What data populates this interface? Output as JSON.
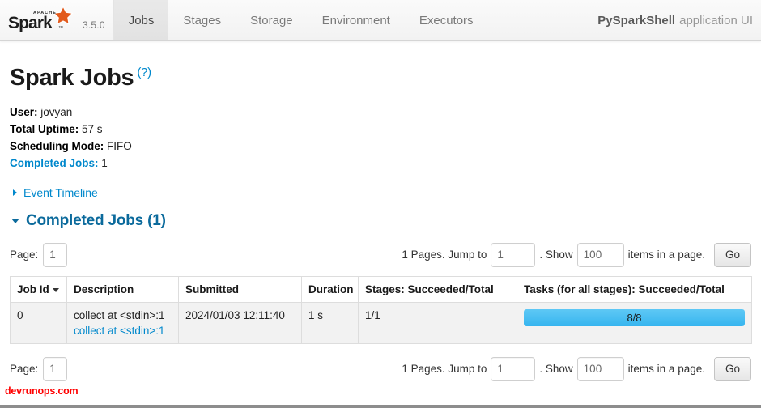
{
  "navbar": {
    "logo_alt": "Apache Spark",
    "logo_apache_text": "APACHE",
    "logo_word": "Spark",
    "version": "3.5.0",
    "tabs": [
      {
        "label": "Jobs",
        "active": true
      },
      {
        "label": "Stages",
        "active": false
      },
      {
        "label": "Storage",
        "active": false
      },
      {
        "label": "Environment",
        "active": false
      },
      {
        "label": "Executors",
        "active": false
      }
    ],
    "app_name": "PySparkShell",
    "app_suffix": "application UI"
  },
  "page": {
    "title": "Spark Jobs",
    "help_label": "(?)"
  },
  "summary": {
    "user_label": "User:",
    "user_value": "jovyan",
    "uptime_label": "Total Uptime:",
    "uptime_value": "57 s",
    "scheduling_label": "Scheduling Mode:",
    "scheduling_value": "FIFO",
    "completed_label": "Completed Jobs:",
    "completed_value": "1"
  },
  "event_timeline": {
    "label": "Event Timeline"
  },
  "completed_section": {
    "title": "Completed Jobs (1)"
  },
  "pagination": {
    "page_label": "Page:",
    "page_value": "1",
    "pages_text": "1 Pages. Jump to",
    "jump_value": "1",
    "show_text": ". Show",
    "show_value": "100",
    "items_text": "items in a page.",
    "go_label": "Go"
  },
  "table": {
    "columns": [
      "Job Id",
      "Description",
      "Submitted",
      "Duration",
      "Stages: Succeeded/Total",
      "Tasks (for all stages): Succeeded/Total"
    ],
    "sorted_column_index": 0,
    "rows": [
      {
        "job_id": "0",
        "description_main": "collect at <stdin>:1",
        "description_link": "collect at <stdin>:1",
        "submitted": "2024/01/03 12:11:40",
        "duration": "1 s",
        "stages": "1/1",
        "tasks_label": "8/8",
        "tasks_percent": 100
      }
    ]
  },
  "footer": {
    "watermark": "devrunops.com"
  },
  "colors": {
    "link": "#0088cc",
    "section_title": "#0b6a9c",
    "progress": "#36b5ef",
    "watermark": "#ff0000",
    "logo_star": "#e25a1c"
  }
}
